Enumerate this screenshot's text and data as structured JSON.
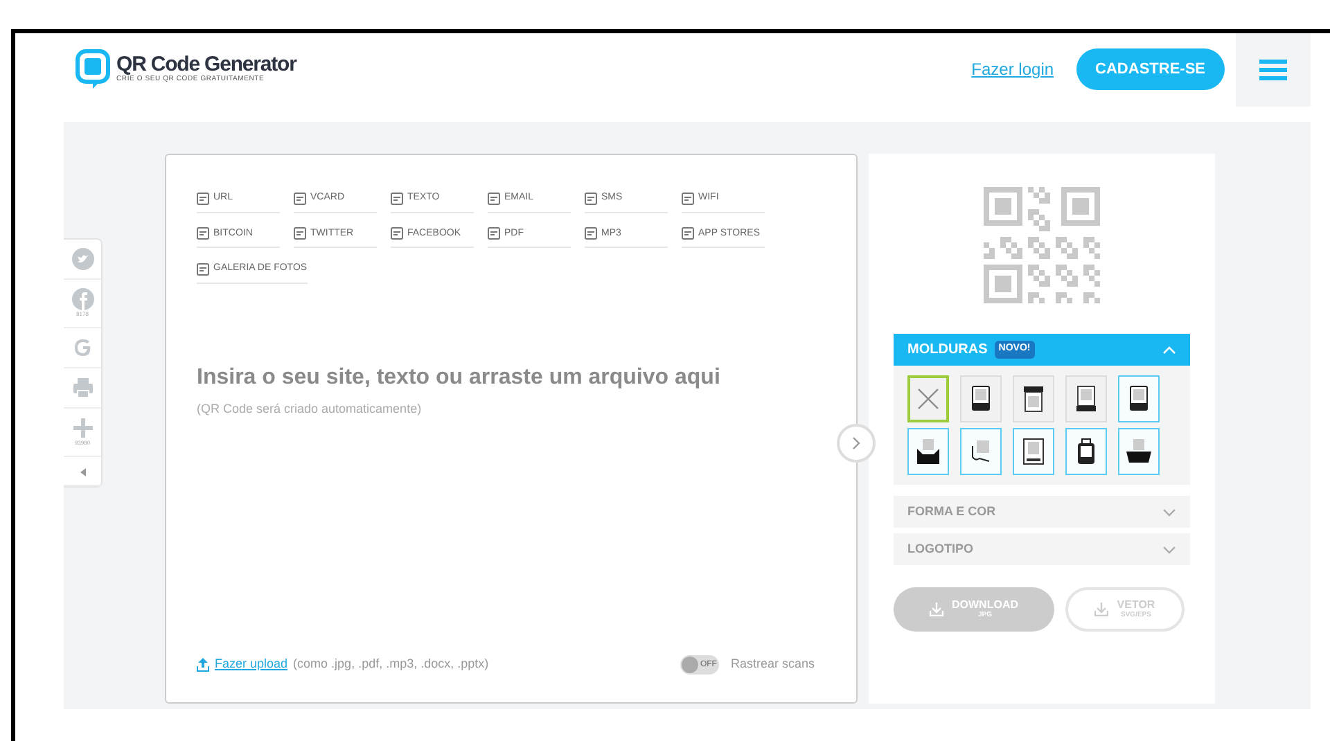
{
  "header": {
    "logo_title": "QR Code Generator",
    "logo_subtitle": "CRIE O SEU QR CODE GRATUITAMENTE",
    "login": "Fazer login",
    "signup": "CADASTRE-SE"
  },
  "share_sidebar": [
    {
      "kind": "twitter"
    },
    {
      "kind": "facebook",
      "count": "8178"
    },
    {
      "kind": "google"
    },
    {
      "kind": "print"
    },
    {
      "kind": "plus",
      "count": "93980"
    },
    {
      "kind": "collapse"
    }
  ],
  "types": [
    {
      "label": "URL"
    },
    {
      "label": "VCARD"
    },
    {
      "label": "TEXTO"
    },
    {
      "label": "EMAIL"
    },
    {
      "label": "SMS"
    },
    {
      "label": "WIFI"
    },
    {
      "label": "BITCOIN"
    },
    {
      "label": "TWITTER"
    },
    {
      "label": "FACEBOOK"
    },
    {
      "label": "PDF"
    },
    {
      "label": "MP3"
    },
    {
      "label": "APP STORES"
    },
    {
      "label": "GALERIA DE FOTOS"
    }
  ],
  "input": {
    "headline": "Insira o seu site, texto ou arraste um arquivo aqui",
    "hint": "(QR Code será criado automaticamente)",
    "upload_link": "Fazer upload",
    "upload_formats": "(como .jpg, .pdf, .mp3, .docx, .pptx)",
    "track_toggle": {
      "label": "Rastrear scans",
      "state_text": "OFF",
      "on": false
    }
  },
  "frames": {
    "title": "MOLDURAS",
    "badge": "NOVO!",
    "expanded": true,
    "options": [
      {
        "selected": true,
        "highlighted": false,
        "kind": "none"
      },
      {
        "selected": false,
        "highlighted": false,
        "kind": "bottom"
      },
      {
        "selected": false,
        "highlighted": false,
        "kind": "top"
      },
      {
        "selected": false,
        "highlighted": false,
        "kind": "tab"
      },
      {
        "selected": false,
        "highlighted": true,
        "kind": "bottom"
      },
      {
        "selected": false,
        "highlighted": true,
        "kind": "box"
      },
      {
        "selected": false,
        "highlighted": true,
        "kind": "script"
      },
      {
        "selected": false,
        "highlighted": true,
        "kind": "border"
      },
      {
        "selected": false,
        "highlighted": true,
        "kind": "bag"
      },
      {
        "selected": false,
        "highlighted": true,
        "kind": "tray"
      }
    ]
  },
  "sections": [
    {
      "title": "FORMA E COR",
      "expanded": false
    },
    {
      "title": "LOGOTIPO",
      "expanded": false
    }
  ],
  "download": {
    "label": "DOWNLOAD",
    "format": "JPG",
    "disabled": true
  },
  "vector": {
    "label": "VETOR",
    "format": "SVG/EPS",
    "disabled": true
  }
}
